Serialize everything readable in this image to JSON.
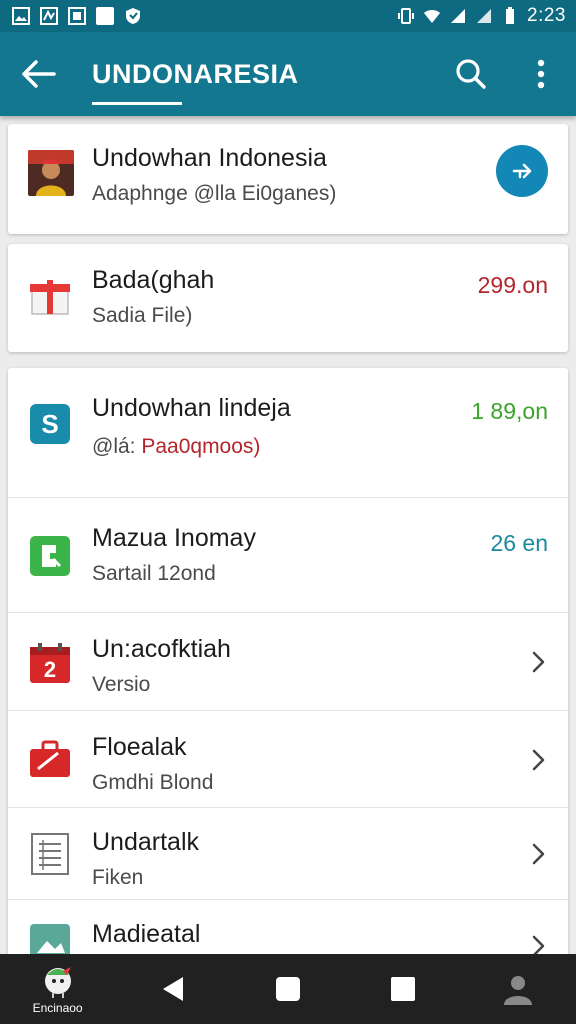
{
  "status_bar": {
    "time": "2:23"
  },
  "app_bar": {
    "title": "UNDONARESIA"
  },
  "cards": {
    "profile": {
      "title": "Undowhan Indonesia",
      "subtitle": "Adaphnge @lla Ei0ganes)"
    },
    "file": {
      "title": "Bada(ghah",
      "subtitle": "Sadia File)",
      "value": "299.on",
      "value_color": "#b3262b"
    },
    "list": {
      "items": [
        {
          "title": "Undowhan lindeja",
          "subtitle_prefix": "@lá: ",
          "subtitle": "Paa0qmoos)",
          "value": "1 89,on",
          "value_color": "#3aa52a",
          "icon": "s-badge-icon"
        },
        {
          "title": "Mazua Inomay",
          "subtitle": "Sartail 12ond",
          "value": "26 en",
          "value_color": "#1a8aa0",
          "icon": "doc-green-icon"
        },
        {
          "title": "Un:acofktiah",
          "subtitle": "Versio",
          "icon": "calendar-icon"
        },
        {
          "title": "Floealak",
          "subtitle": "Gmdhi Blond",
          "icon": "briefcase-icon"
        },
        {
          "title": "Undartalk",
          "subtitle": "Fiken",
          "icon": "document-icon"
        },
        {
          "title": "Madieatal",
          "subtitle": "",
          "icon": "image-icon"
        }
      ]
    }
  },
  "nav_bar": {
    "app_label": "Encinaoo"
  },
  "colors": {
    "app_bar": "#12778f",
    "status_bar": "#0e6a80",
    "accent": "#1387b5"
  }
}
